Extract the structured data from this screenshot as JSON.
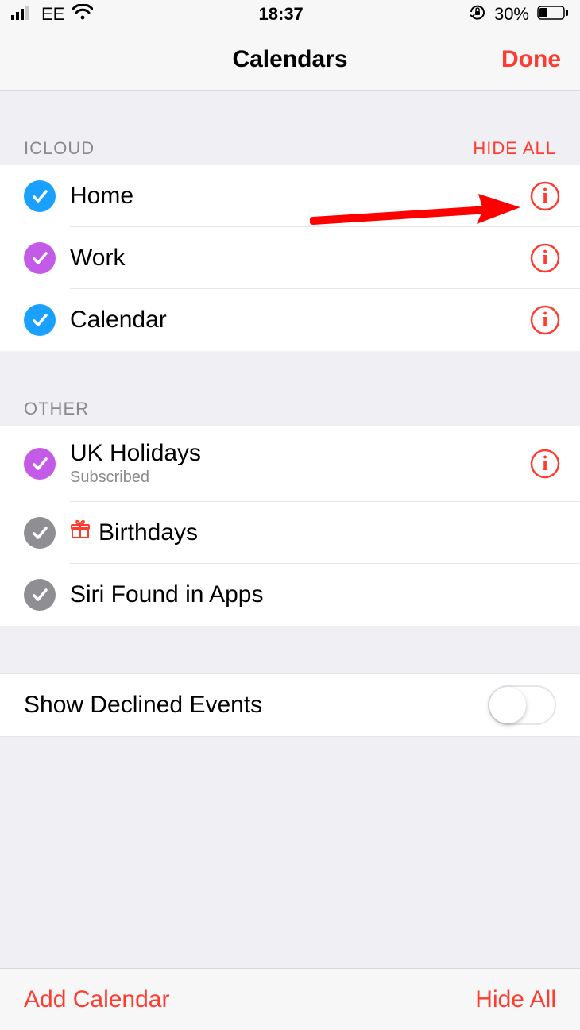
{
  "status": {
    "carrier": "EE",
    "time": "18:37",
    "battery_pct": "30%"
  },
  "nav": {
    "title": "Calendars",
    "done": "Done"
  },
  "sections": {
    "icloud": {
      "header": "ICLOUD",
      "hide": "HIDE ALL",
      "items": [
        {
          "label": "Home",
          "color": "#1aa1ff",
          "info": true
        },
        {
          "label": "Work",
          "color": "#c35be8",
          "info": true
        },
        {
          "label": "Calendar",
          "color": "#1aa1ff",
          "info": true
        }
      ]
    },
    "other": {
      "header": "OTHER",
      "items": [
        {
          "label": "UK Holidays",
          "sub": "Subscribed",
          "color": "#c35be8",
          "info": true
        },
        {
          "label": "Birthdays",
          "color": "#8e8e93",
          "gift": true
        },
        {
          "label": "Siri Found in Apps",
          "color": "#8e8e93"
        }
      ]
    }
  },
  "declined": {
    "label": "Show Declined Events",
    "on": false
  },
  "toolbar": {
    "add": "Add Calendar",
    "hide": "Hide All"
  }
}
